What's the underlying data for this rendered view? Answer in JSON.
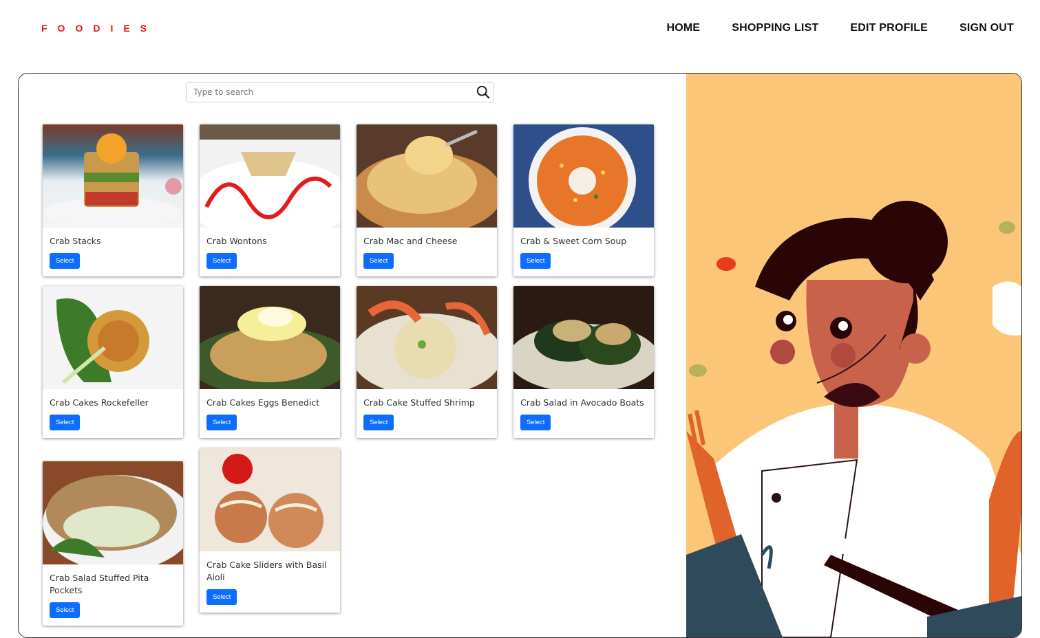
{
  "brand": {
    "logo_text": "FOODIES",
    "accent_color": "#e0141c"
  },
  "nav": {
    "items": [
      "HOME",
      "SHOPPING LIST",
      "EDIT PROFILE",
      "SIGN OUT"
    ]
  },
  "search": {
    "placeholder": "Type to search",
    "icon": "search-icon"
  },
  "recipes": [
    {
      "title": "Crab Stacks",
      "button": "Select"
    },
    {
      "title": "Crab Wontons",
      "button": "Select"
    },
    {
      "title": "Crab Mac and Cheese",
      "button": "Select"
    },
    {
      "title": "Crab & Sweet Corn Soup",
      "button": "Select"
    },
    {
      "title": "Crab Cakes Rockefeller",
      "button": "Select"
    },
    {
      "title": "Crab Cakes Eggs Benedict",
      "button": "Select"
    },
    {
      "title": "Crab Cake Stuffed Shrimp",
      "button": "Select"
    },
    {
      "title": "Crab Salad in Avocado Boats",
      "button": "Select"
    },
    {
      "title": "Crab Salad Stuffed Pita Pockets",
      "button": "Select"
    },
    {
      "title": "Crab Cake Sliders with Basil Aioli",
      "button": "Select"
    }
  ],
  "colors": {
    "button": "#0d6efd",
    "hero_background": "#fcc679"
  }
}
